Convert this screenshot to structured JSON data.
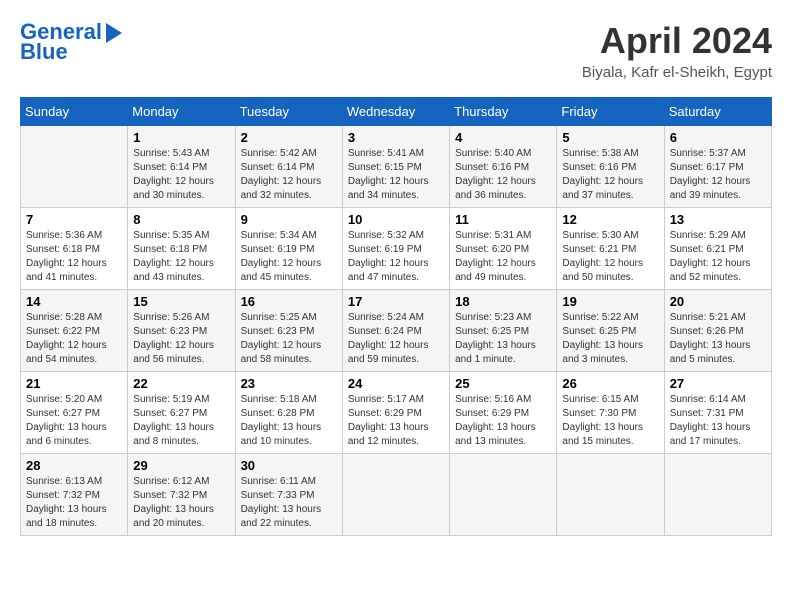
{
  "header": {
    "logo_line1": "General",
    "logo_line2": "Blue",
    "month": "April 2024",
    "location": "Biyala, Kafr el-Sheikh, Egypt"
  },
  "days_of_week": [
    "Sunday",
    "Monday",
    "Tuesday",
    "Wednesday",
    "Thursday",
    "Friday",
    "Saturday"
  ],
  "weeks": [
    [
      {
        "day": "",
        "info": ""
      },
      {
        "day": "1",
        "info": "Sunrise: 5:43 AM\nSunset: 6:14 PM\nDaylight: 12 hours\nand 30 minutes."
      },
      {
        "day": "2",
        "info": "Sunrise: 5:42 AM\nSunset: 6:14 PM\nDaylight: 12 hours\nand 32 minutes."
      },
      {
        "day": "3",
        "info": "Sunrise: 5:41 AM\nSunset: 6:15 PM\nDaylight: 12 hours\nand 34 minutes."
      },
      {
        "day": "4",
        "info": "Sunrise: 5:40 AM\nSunset: 6:16 PM\nDaylight: 12 hours\nand 36 minutes."
      },
      {
        "day": "5",
        "info": "Sunrise: 5:38 AM\nSunset: 6:16 PM\nDaylight: 12 hours\nand 37 minutes."
      },
      {
        "day": "6",
        "info": "Sunrise: 5:37 AM\nSunset: 6:17 PM\nDaylight: 12 hours\nand 39 minutes."
      }
    ],
    [
      {
        "day": "7",
        "info": "Sunrise: 5:36 AM\nSunset: 6:18 PM\nDaylight: 12 hours\nand 41 minutes."
      },
      {
        "day": "8",
        "info": "Sunrise: 5:35 AM\nSunset: 6:18 PM\nDaylight: 12 hours\nand 43 minutes."
      },
      {
        "day": "9",
        "info": "Sunrise: 5:34 AM\nSunset: 6:19 PM\nDaylight: 12 hours\nand 45 minutes."
      },
      {
        "day": "10",
        "info": "Sunrise: 5:32 AM\nSunset: 6:19 PM\nDaylight: 12 hours\nand 47 minutes."
      },
      {
        "day": "11",
        "info": "Sunrise: 5:31 AM\nSunset: 6:20 PM\nDaylight: 12 hours\nand 49 minutes."
      },
      {
        "day": "12",
        "info": "Sunrise: 5:30 AM\nSunset: 6:21 PM\nDaylight: 12 hours\nand 50 minutes."
      },
      {
        "day": "13",
        "info": "Sunrise: 5:29 AM\nSunset: 6:21 PM\nDaylight: 12 hours\nand 52 minutes."
      }
    ],
    [
      {
        "day": "14",
        "info": "Sunrise: 5:28 AM\nSunset: 6:22 PM\nDaylight: 12 hours\nand 54 minutes."
      },
      {
        "day": "15",
        "info": "Sunrise: 5:26 AM\nSunset: 6:23 PM\nDaylight: 12 hours\nand 56 minutes."
      },
      {
        "day": "16",
        "info": "Sunrise: 5:25 AM\nSunset: 6:23 PM\nDaylight: 12 hours\nand 58 minutes."
      },
      {
        "day": "17",
        "info": "Sunrise: 5:24 AM\nSunset: 6:24 PM\nDaylight: 12 hours\nand 59 minutes."
      },
      {
        "day": "18",
        "info": "Sunrise: 5:23 AM\nSunset: 6:25 PM\nDaylight: 13 hours\nand 1 minute."
      },
      {
        "day": "19",
        "info": "Sunrise: 5:22 AM\nSunset: 6:25 PM\nDaylight: 13 hours\nand 3 minutes."
      },
      {
        "day": "20",
        "info": "Sunrise: 5:21 AM\nSunset: 6:26 PM\nDaylight: 13 hours\nand 5 minutes."
      }
    ],
    [
      {
        "day": "21",
        "info": "Sunrise: 5:20 AM\nSunset: 6:27 PM\nDaylight: 13 hours\nand 6 minutes."
      },
      {
        "day": "22",
        "info": "Sunrise: 5:19 AM\nSunset: 6:27 PM\nDaylight: 13 hours\nand 8 minutes."
      },
      {
        "day": "23",
        "info": "Sunrise: 5:18 AM\nSunset: 6:28 PM\nDaylight: 13 hours\nand 10 minutes."
      },
      {
        "day": "24",
        "info": "Sunrise: 5:17 AM\nSunset: 6:29 PM\nDaylight: 13 hours\nand 12 minutes."
      },
      {
        "day": "25",
        "info": "Sunrise: 5:16 AM\nSunset: 6:29 PM\nDaylight: 13 hours\nand 13 minutes."
      },
      {
        "day": "26",
        "info": "Sunrise: 6:15 AM\nSunset: 7:30 PM\nDaylight: 13 hours\nand 15 minutes."
      },
      {
        "day": "27",
        "info": "Sunrise: 6:14 AM\nSunset: 7:31 PM\nDaylight: 13 hours\nand 17 minutes."
      }
    ],
    [
      {
        "day": "28",
        "info": "Sunrise: 6:13 AM\nSunset: 7:32 PM\nDaylight: 13 hours\nand 18 minutes."
      },
      {
        "day": "29",
        "info": "Sunrise: 6:12 AM\nSunset: 7:32 PM\nDaylight: 13 hours\nand 20 minutes."
      },
      {
        "day": "30",
        "info": "Sunrise: 6:11 AM\nSunset: 7:33 PM\nDaylight: 13 hours\nand 22 minutes."
      },
      {
        "day": "",
        "info": ""
      },
      {
        "day": "",
        "info": ""
      },
      {
        "day": "",
        "info": ""
      },
      {
        "day": "",
        "info": ""
      }
    ]
  ]
}
